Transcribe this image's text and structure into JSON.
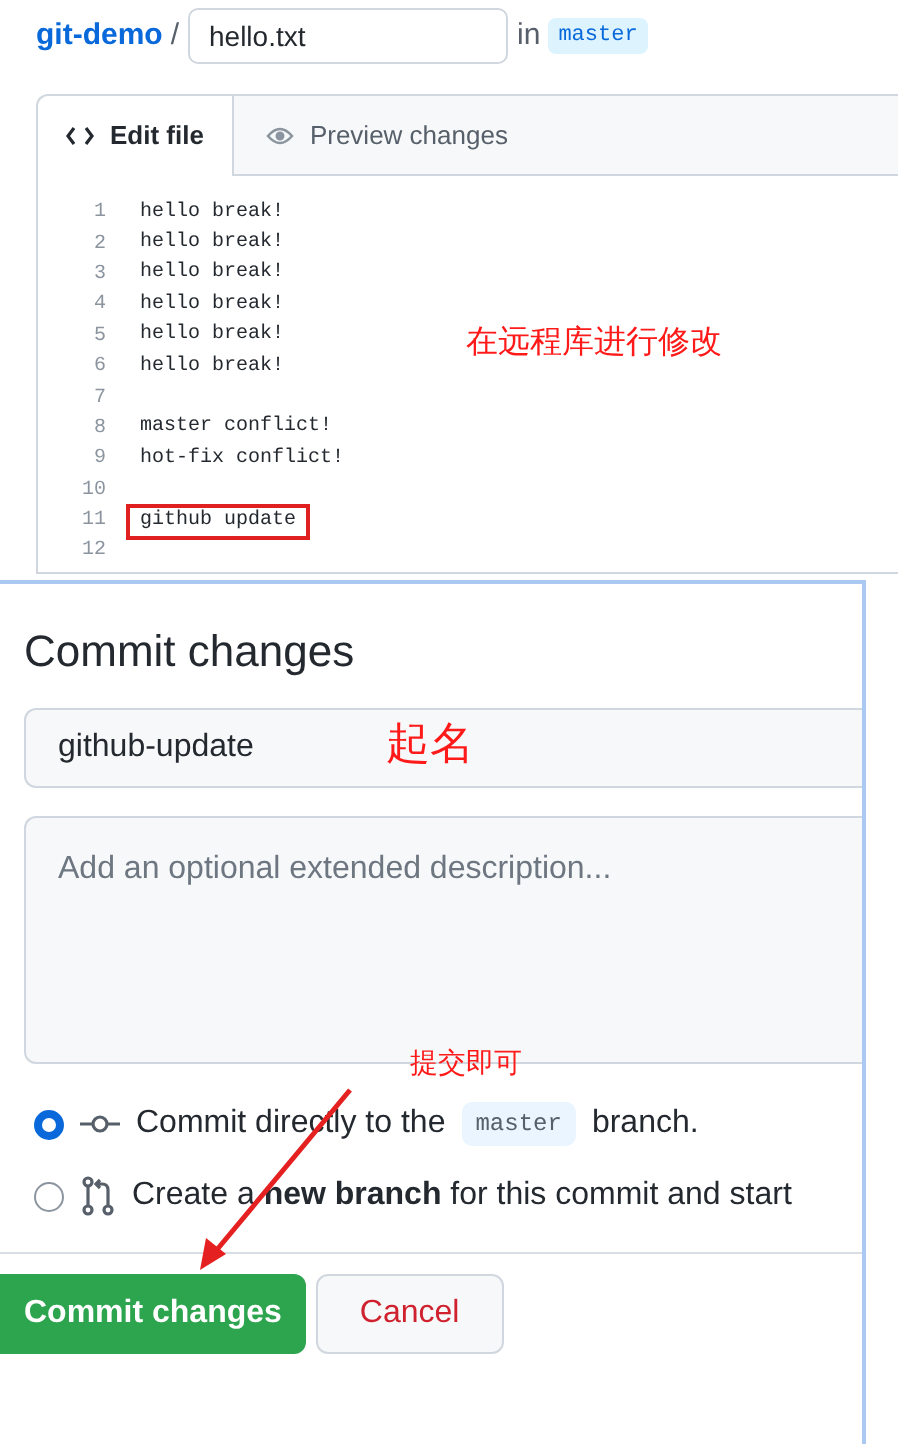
{
  "breadcrumb": {
    "repo": "git-demo",
    "separator": "/",
    "filename": "hello.txt",
    "in_label": "in",
    "branch": "master"
  },
  "tabs": [
    {
      "label": "Edit file",
      "selected": true,
      "kind": "code"
    },
    {
      "label": "Preview changes",
      "selected": false,
      "kind": "eye"
    }
  ],
  "code_lines": [
    {
      "number": "1",
      "text": "hello break!",
      "boxed": false
    },
    {
      "number": "2",
      "text": "hello break!",
      "boxed": false
    },
    {
      "number": "3",
      "text": "hello break!",
      "boxed": false
    },
    {
      "number": "4",
      "text": "hello break!",
      "boxed": false
    },
    {
      "number": "5",
      "text": "hello break!",
      "boxed": false
    },
    {
      "number": "6",
      "text": "hello break!",
      "boxed": false
    },
    {
      "number": "7",
      "boxed": false
    },
    {
      "number": "8",
      "text": "master conflict!",
      "boxed": false
    },
    {
      "number": "9",
      "text": "hot-fix conflict!",
      "boxed": false
    },
    {
      "number": "10",
      "boxed": false
    },
    {
      "number": "11",
      "text": "github update",
      "boxed": true
    },
    {
      "number": "12",
      "boxed": false
    }
  ],
  "commit": {
    "title": "Commit changes",
    "summary_value": "github-update",
    "description_placeholder": "Add an optional extended description...",
    "options": [
      {
        "kind": "commit",
        "selected": true,
        "text_before": "Commit directly to the",
        "branch": "master",
        "text_after": "branch."
      },
      {
        "kind": "branch",
        "selected": false,
        "text": "Create a **new branch** for this commit and start"
      }
    ],
    "buttons": [
      {
        "kind": "primary",
        "label": "Commit changes"
      },
      {
        "kind": "cancel",
        "label": "Cancel"
      }
    ]
  },
  "annotations": [
    {
      "kind": "note",
      "text": "在远程库进行修改"
    },
    {
      "kind": "note",
      "text": "起名"
    },
    {
      "kind": "note",
      "text": "提交即可"
    }
  ]
}
